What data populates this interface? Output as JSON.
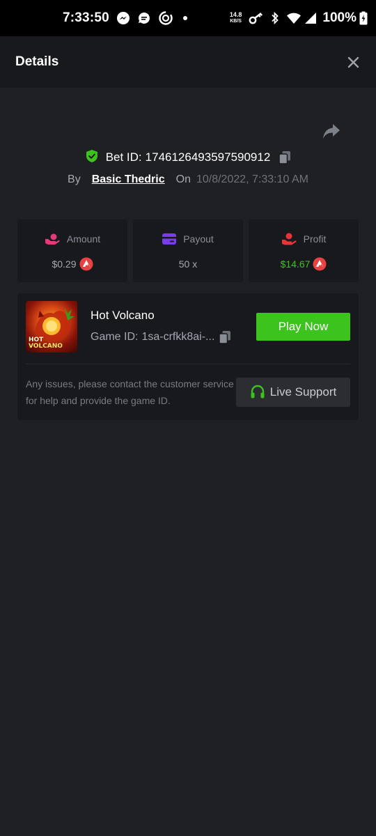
{
  "status_bar": {
    "time": "7:33:50",
    "net_speed_value": "14.8",
    "net_speed_unit": "KB/S",
    "battery": "100%",
    "icons": [
      "messenger-icon",
      "chat-icon",
      "sync-app-icon",
      "dot",
      "key-icon",
      "bluetooth-icon",
      "wifi-icon",
      "signal-icon",
      "battery-charging-icon"
    ]
  },
  "header": {
    "title": "Details",
    "close_icon": "close-icon"
  },
  "bet": {
    "id_label": "Bet ID:",
    "id_value": "1746126493597590912",
    "by_label": "By",
    "user": "Basic Thedric",
    "on_label": "On",
    "date": "10/8/2022, 7:33:10 AM"
  },
  "stats": {
    "amount": {
      "label": "Amount",
      "value": "$0.29",
      "icon": "amount-hand-icon"
    },
    "payout": {
      "label": "Payout",
      "value": "50 x",
      "icon": "wallet-icon"
    },
    "profit": {
      "label": "Profit",
      "value": "$14.67",
      "icon": "profit-hand-icon"
    }
  },
  "game": {
    "name": "Hot Volcano",
    "id_label": "Game ID:",
    "id_value": "1sa-crfkk8ai-...",
    "thumb_line1": "HOT",
    "thumb_line2": "VOLCANO",
    "play_label": "Play Now",
    "issue_text": "Any issues, please contact the customer service for help and provide the game ID.",
    "support_label": "Live Support"
  },
  "colors": {
    "background": "#1f2023",
    "card": "#18191c",
    "accent_green": "#3cc31e",
    "amount_pink": "#e23c78",
    "payout_purple": "#7a3cf0",
    "profit_red": "#e8333a",
    "coin_red": "#e84142"
  }
}
